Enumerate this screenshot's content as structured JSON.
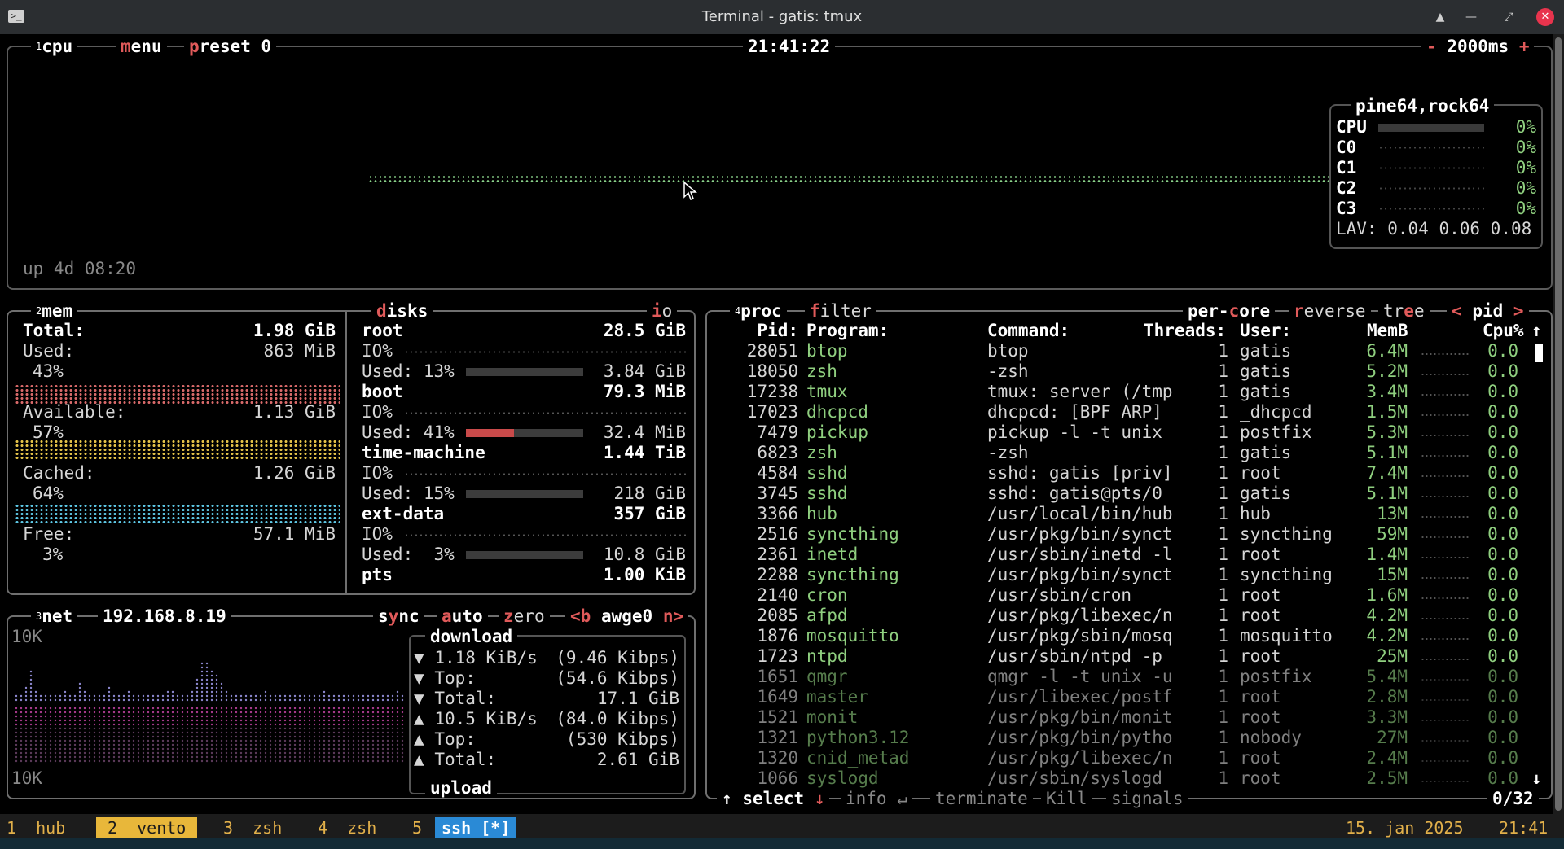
{
  "window": {
    "title": "Terminal - gatis: tmux"
  },
  "cpu_panel": {
    "num": "1",
    "label": "cpu",
    "menu": "menu",
    "preset": "preset 0",
    "clock": "21:41:22",
    "interval": "2000ms",
    "minus": "-",
    "plus": "+",
    "uptime": "up 4d 08:20",
    "host": "pine64,rock64",
    "rows": [
      {
        "name": "CPU",
        "pct": "0%"
      },
      {
        "name": "C0",
        "pct": "0%"
      },
      {
        "name": "C1",
        "pct": "0%"
      },
      {
        "name": "C2",
        "pct": "0%"
      },
      {
        "name": "C3",
        "pct": "0%"
      }
    ],
    "lav_label": "LAV:",
    "lav": "0.04 0.06 0.08"
  },
  "mem_panel": {
    "num": "2",
    "label": "mem",
    "total_label": "Total:",
    "total": "1.98 GiB",
    "used_label": "Used:",
    "used": "863 MiB",
    "used_pct": "43%",
    "avail_label": "Available:",
    "avail": "1.13 GiB",
    "avail_pct": "57%",
    "cached_label": "Cached:",
    "cached": "1.26 GiB",
    "cached_pct": "64%",
    "free_label": "Free:",
    "free": "57.1 MiB",
    "free_pct": "3%",
    "colors": {
      "used": "#d96a6a",
      "avail": "#e6c44a",
      "cached": "#5ec8e6",
      "free": "#8fd48f"
    }
  },
  "disks_panel": {
    "label": "disks",
    "io": "io",
    "disks": [
      {
        "name": "root",
        "size": "28.5 GiB",
        "io": "IO%",
        "used": "Used: 13%",
        "used_val": "3.84 GiB",
        "pct": 0.13
      },
      {
        "name": "boot",
        "size": "79.3 MiB",
        "io": "IO%",
        "used": "Used: 41%",
        "used_val": "32.4 MiB",
        "pct": 0.41
      },
      {
        "name": "time-machine",
        "size": "1.44 TiB",
        "io": "IO%",
        "used": "Used: 15%",
        "used_val": "218 GiB",
        "pct": 0.15
      },
      {
        "name": "ext-data",
        "size": "357 GiB",
        "io": "IO%",
        "used": "Used:  3%",
        "used_val": "10.8 GiB",
        "pct": 0.03
      }
    ],
    "pts_name": "pts",
    "pts_size": "1.00 KiB"
  },
  "net_panel": {
    "num": "3",
    "label": "net",
    "ip": "192.168.8.19",
    "sync": "sync",
    "auto": "auto",
    "zero": "zero",
    "prev": "<b",
    "iface": "awge0",
    "next": "n>",
    "scale_top": "10K",
    "scale_bottom": "10K",
    "download_label": "download",
    "upload_label": "upload",
    "rows": [
      {
        "arrow": "▼",
        "label": "1.18 KiB/s",
        "val": "(9.46 Kibps)"
      },
      {
        "arrow": "▼",
        "label": "Top:",
        "val": "(54.6 Kibps)"
      },
      {
        "arrow": "▼",
        "label": "Total:",
        "val": "17.1 GiB"
      },
      {
        "arrow": "▲",
        "label": "10.5 KiB/s",
        "val": "(84.0 Kibps)"
      },
      {
        "arrow": "▲",
        "label": "Top:",
        "val": "(530 Kibps)"
      },
      {
        "arrow": "▲",
        "label": "Total:",
        "val": "2.61 GiB"
      }
    ]
  },
  "proc_panel": {
    "num": "4",
    "label": "proc",
    "filter": "filter",
    "per_core": "per-core",
    "reverse": "reverse",
    "tree": "tree",
    "sort_prev": "<",
    "sort": "pid",
    "sort_next": ">",
    "headers": {
      "pid": "Pid:",
      "program": "Program:",
      "command": "Command:",
      "threads": "Threads:",
      "user": "User:",
      "mem": "MemB",
      "cpu": "Cpu%"
    },
    "rows": [
      {
        "pid": "28051",
        "program": "btop",
        "command": "btop",
        "threads": "1",
        "user": "gatis",
        "mem": "6.4M",
        "cpu": "0.0"
      },
      {
        "pid": "18050",
        "program": "zsh",
        "command": "-zsh",
        "threads": "1",
        "user": "gatis",
        "mem": "5.2M",
        "cpu": "0.0"
      },
      {
        "pid": "17238",
        "program": "tmux",
        "command": "tmux: server (/tmp",
        "threads": "1",
        "user": "gatis",
        "mem": "3.4M",
        "cpu": "0.0"
      },
      {
        "pid": "17023",
        "program": "dhcpcd",
        "command": "dhcpcd: [BPF ARP]",
        "threads": "1",
        "user": "_dhcpcd",
        "mem": "1.5M",
        "cpu": "0.0"
      },
      {
        "pid": "7479",
        "program": "pickup",
        "command": "pickup -l -t unix",
        "threads": "1",
        "user": "postfix",
        "mem": "5.3M",
        "cpu": "0.0"
      },
      {
        "pid": "6823",
        "program": "zsh",
        "command": "-zsh",
        "threads": "1",
        "user": "gatis",
        "mem": "5.1M",
        "cpu": "0.0"
      },
      {
        "pid": "4584",
        "program": "sshd",
        "command": "sshd: gatis [priv]",
        "threads": "1",
        "user": "root",
        "mem": "7.4M",
        "cpu": "0.0"
      },
      {
        "pid": "3745",
        "program": "sshd",
        "command": "sshd: gatis@pts/0",
        "threads": "1",
        "user": "gatis",
        "mem": "5.1M",
        "cpu": "0.0"
      },
      {
        "pid": "3366",
        "program": "hub",
        "command": "/usr/local/bin/hub",
        "threads": "1",
        "user": "hub",
        "mem": "13M",
        "cpu": "0.0"
      },
      {
        "pid": "2516",
        "program": "syncthing",
        "command": "/usr/pkg/bin/synct",
        "threads": "1",
        "user": "syncthing",
        "mem": "59M",
        "cpu": "0.0"
      },
      {
        "pid": "2361",
        "program": "inetd",
        "command": "/usr/sbin/inetd -l",
        "threads": "1",
        "user": "root",
        "mem": "1.4M",
        "cpu": "0.0"
      },
      {
        "pid": "2288",
        "program": "syncthing",
        "command": "/usr/pkg/bin/synct",
        "threads": "1",
        "user": "syncthing",
        "mem": "15M",
        "cpu": "0.0"
      },
      {
        "pid": "2140",
        "program": "cron",
        "command": "/usr/sbin/cron",
        "threads": "1",
        "user": "root",
        "mem": "1.6M",
        "cpu": "0.0"
      },
      {
        "pid": "2085",
        "program": "afpd",
        "command": "/usr/pkg/libexec/n",
        "threads": "1",
        "user": "root",
        "mem": "4.2M",
        "cpu": "0.0"
      },
      {
        "pid": "1876",
        "program": "mosquitto",
        "command": "/usr/pkg/sbin/mosq",
        "threads": "1",
        "user": "mosquitto",
        "mem": "4.2M",
        "cpu": "0.0"
      },
      {
        "pid": "1723",
        "program": "ntpd",
        "command": "/usr/sbin/ntpd -p",
        "threads": "1",
        "user": "root",
        "mem": "25M",
        "cpu": "0.0"
      },
      {
        "pid": "1651",
        "program": "qmgr",
        "command": "qmgr -l -t unix -u",
        "threads": "1",
        "user": "postfix",
        "mem": "5.4M",
        "cpu": "0.0"
      },
      {
        "pid": "1649",
        "program": "master",
        "command": "/usr/libexec/postf",
        "threads": "1",
        "user": "root",
        "mem": "2.8M",
        "cpu": "0.0"
      },
      {
        "pid": "1521",
        "program": "monit",
        "command": "/usr/pkg/bin/monit",
        "threads": "1",
        "user": "root",
        "mem": "3.3M",
        "cpu": "0.0"
      },
      {
        "pid": "1321",
        "program": "python3.12",
        "command": "/usr/pkg/bin/pytho",
        "threads": "1",
        "user": "nobody",
        "mem": "27M",
        "cpu": "0.0"
      },
      {
        "pid": "1320",
        "program": "cnid_metad",
        "command": "/usr/pkg/libexec/n",
        "threads": "1",
        "user": "root",
        "mem": "2.4M",
        "cpu": "0.0"
      },
      {
        "pid": "1066",
        "program": "syslogd",
        "command": "/usr/sbin/syslogd",
        "threads": "1",
        "user": "root",
        "mem": "2.5M",
        "cpu": "0.0"
      }
    ],
    "footer": {
      "up": "↑",
      "select": "select",
      "down": "↓",
      "info": "info",
      "enter": "↵",
      "terminate": "terminate",
      "kill": "Kill",
      "signals": "signals",
      "count": "0/32"
    }
  },
  "tmux": {
    "windows": [
      {
        "num": "1",
        "name": "hub"
      },
      {
        "num": "2",
        "name": "vento"
      },
      {
        "num": "3",
        "name": "zsh"
      },
      {
        "num": "4",
        "name": "zsh"
      },
      {
        "num": "5",
        "name": "ssh [*]"
      }
    ],
    "date": "15. jan 2025",
    "time": "21:41"
  }
}
